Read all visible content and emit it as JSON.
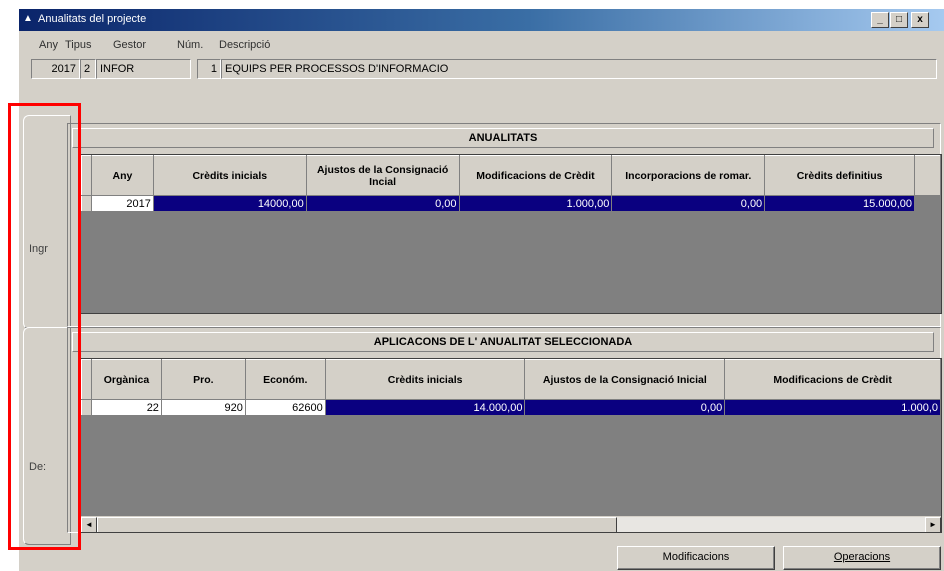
{
  "window": {
    "title": "Anualitats del projecte",
    "controls": {
      "minimize": "_",
      "maximize": "□",
      "close": "x"
    }
  },
  "header": {
    "labels": {
      "any": "Any",
      "tipus": "Tipus",
      "gestor": "Gestor",
      "num": "Núm.",
      "descripcio": "Descripció"
    },
    "values": {
      "any": "2017",
      "tipus": "2",
      "gestor": "INFOR",
      "num": "1",
      "descripcio": "EQUIPS PER PROCESSOS D'INFORMACIO"
    }
  },
  "side_tabs": [
    {
      "label": "Ingr"
    },
    {
      "label": "De:"
    }
  ],
  "anualitats": {
    "title": "ANUALITATS",
    "columns": [
      "Any",
      "Crèdits inicials",
      "Ajustos de la Consignació Incial",
      "Modificacions de Crèdit",
      "Incorporacions de romar.",
      "Crèdits definitius"
    ],
    "rows": [
      [
        "2017",
        "14000,00",
        "0,00",
        "1.000,00",
        "0,00",
        "15.000,00"
      ]
    ]
  },
  "aplicacions": {
    "title": "APLICACONS DE L' ANUALITAT SELECCIONADA",
    "columns": [
      "Orgànica",
      "Pro.",
      "Económ.",
      "Crèdits inicials",
      "Ajustos de la Consignació Inicial",
      "Modificacions de Crèdit"
    ],
    "rows": [
      [
        "22",
        "920",
        "62600",
        "14.000,00",
        "0,00",
        "1.000,0"
      ]
    ]
  },
  "scrollbar": {
    "left": "◄",
    "right": "►"
  },
  "buttons": {
    "modificacions": "Modificacions",
    "operacions": "Operacions"
  },
  "colors": {
    "selection": "#0a0080",
    "highlight_box": "#ff0000",
    "titlebar": "#0a246a"
  }
}
